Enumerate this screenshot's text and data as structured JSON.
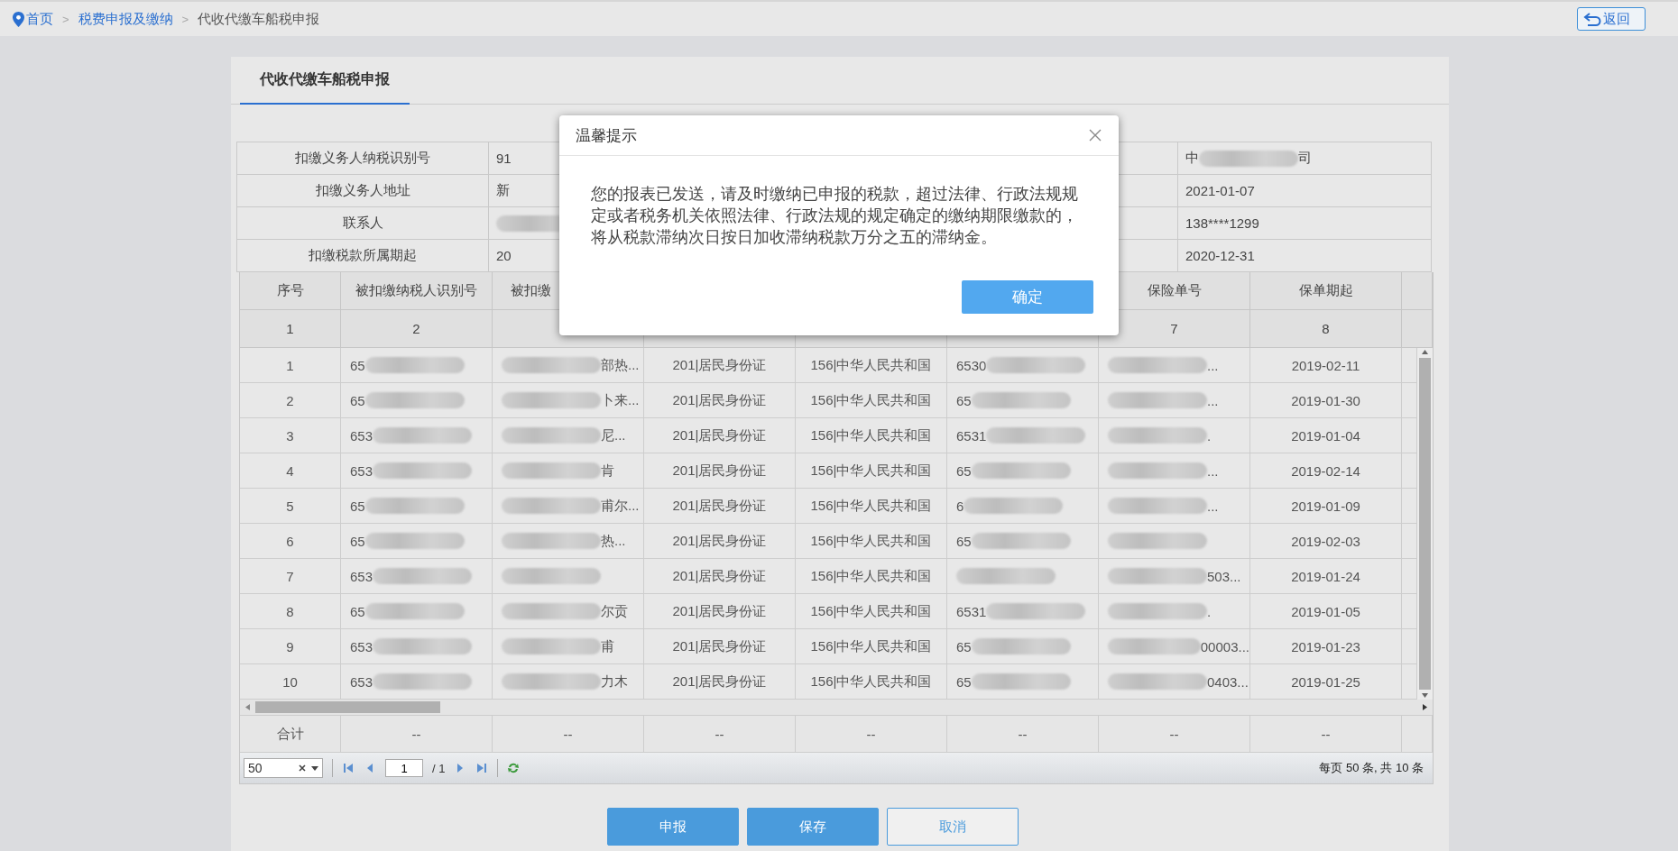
{
  "breadcrumb": [
    {
      "kind": "home",
      "label": "首页"
    },
    {
      "kind": "separator",
      "label": ">"
    },
    {
      "kind": "link",
      "label": "税费申报及缴纳"
    },
    {
      "kind": "separator",
      "label": ">"
    },
    {
      "kind": "current",
      "label": "代收代缴车船税申报"
    }
  ],
  "back_button": {
    "label": "返回"
  },
  "tabs": [
    {
      "label": "代收代缴车船税申报",
      "selected": true
    }
  ],
  "info_table": {
    "rows": [
      {
        "label": "扣缴义务人纳税识别号",
        "value": {
          "pre": "91"
        },
        "value_2": {
          "pre": "中",
          "post": "司",
          "redacted": true
        }
      },
      {
        "label": "扣缴义务人地址",
        "value": {
          "pre": "新"
        },
        "value_2": {
          "pre": "2021-01-07"
        }
      },
      {
        "label": "联系人",
        "value": {
          "redacted": true
        },
        "value_2": {
          "pre": "138****1299"
        }
      },
      {
        "label": "扣缴税款所属期起",
        "value": {
          "pre": "20"
        },
        "value_2": {
          "pre": "2020-12-31"
        }
      }
    ]
  },
  "grid": {
    "columns": [
      {
        "header": "序号",
        "index": "1"
      },
      {
        "header": "被扣缴纳税人识别号",
        "index": "2"
      },
      {
        "header": "被扣缴"
      },
      {},
      {},
      {},
      {
        "header": "保险单号",
        "index": "7"
      },
      {
        "header": "保单期起",
        "index": "8"
      }
    ],
    "rows": [
      {
        "cells": [
          {
            "pre": "1"
          },
          {
            "pre": "65",
            "redacted": true
          },
          {
            "post": "部热...",
            "redacted": true
          },
          {
            "pre": "201|居民身份证"
          },
          {
            "pre": "156|中华人民共和国"
          },
          {
            "pre": "6530",
            "redacted": true
          },
          {
            "post": "...",
            "redacted": true
          },
          {
            "pre": "2019-02-11"
          }
        ]
      },
      {
        "cells": [
          {
            "pre": "2"
          },
          {
            "pre": "65",
            "redacted": true
          },
          {
            "post": "卜来...",
            "redacted": true
          },
          {
            "pre": "201|居民身份证"
          },
          {
            "pre": "156|中华人民共和国"
          },
          {
            "pre": "65",
            "redacted": true
          },
          {
            "post": "...",
            "redacted": true
          },
          {
            "pre": "2019-01-30"
          }
        ]
      },
      {
        "cells": [
          {
            "pre": "3"
          },
          {
            "pre": "653",
            "redacted": true
          },
          {
            "post": "尼...",
            "redacted": true
          },
          {
            "pre": "201|居民身份证"
          },
          {
            "pre": "156|中华人民共和国"
          },
          {
            "pre": "6531",
            "redacted": true
          },
          {
            "post": ".",
            "redacted": true
          },
          {
            "pre": "2019-01-04"
          }
        ]
      },
      {
        "cells": [
          {
            "pre": "4"
          },
          {
            "pre": "653",
            "redacted": true
          },
          {
            "post": "肯",
            "redacted": true
          },
          {
            "pre": "201|居民身份证"
          },
          {
            "pre": "156|中华人民共和国"
          },
          {
            "pre": "65",
            "redacted": true
          },
          {
            "post": "...",
            "redacted": true
          },
          {
            "pre": "2019-02-14"
          }
        ]
      },
      {
        "cells": [
          {
            "pre": "5"
          },
          {
            "pre": "65",
            "redacted": true
          },
          {
            "post": "甫尔...",
            "redacted": true
          },
          {
            "pre": "201|居民身份证"
          },
          {
            "pre": "156|中华人民共和国"
          },
          {
            "pre": "6",
            "redacted": true
          },
          {
            "post": "...",
            "redacted": true
          },
          {
            "pre": "2019-01-09"
          }
        ]
      },
      {
        "cells": [
          {
            "pre": "6"
          },
          {
            "pre": "65",
            "redacted": true
          },
          {
            "post": "热...",
            "redacted": true
          },
          {
            "pre": "201|居民身份证"
          },
          {
            "pre": "156|中华人民共和国"
          },
          {
            "pre": "65",
            "redacted": true
          },
          {
            "redacted": true
          },
          {
            "pre": "2019-02-03"
          }
        ]
      },
      {
        "cells": [
          {
            "pre": "7"
          },
          {
            "pre": "653",
            "redacted": true
          },
          {
            "redacted": true
          },
          {
            "pre": "201|居民身份证"
          },
          {
            "pre": "156|中华人民共和国"
          },
          {
            "redacted": true
          },
          {
            "post": "503...",
            "redacted": true
          },
          {
            "pre": "2019-01-24"
          }
        ]
      },
      {
        "cells": [
          {
            "pre": "8"
          },
          {
            "pre": "65",
            "redacted": true
          },
          {
            "post": "尔贡",
            "redacted": true
          },
          {
            "pre": "201|居民身份证"
          },
          {
            "pre": "156|中华人民共和国"
          },
          {
            "pre": "6531",
            "redacted": true
          },
          {
            "post": ".",
            "redacted": true
          },
          {
            "pre": "2019-01-05"
          }
        ]
      },
      {
        "cells": [
          {
            "pre": "9"
          },
          {
            "pre": "653",
            "redacted": true
          },
          {
            "post": "甫",
            "redacted": true
          },
          {
            "pre": "201|居民身份证"
          },
          {
            "pre": "156|中华人民共和国"
          },
          {
            "pre": "65",
            "redacted": true
          },
          {
            "post": "00003...",
            "redacted": true
          },
          {
            "pre": "2019-01-23"
          }
        ]
      },
      {
        "cells": [
          {
            "pre": "10"
          },
          {
            "pre": "653",
            "redacted": true
          },
          {
            "post": "力木",
            "redacted": true
          },
          {
            "pre": "201|居民身份证"
          },
          {
            "pre": "156|中华人民共和国"
          },
          {
            "pre": "65",
            "redacted": true
          },
          {
            "post": "0403...",
            "redacted": true
          },
          {
            "pre": "2019-01-25"
          }
        ]
      }
    ],
    "totals": {
      "label": "合计",
      "values": [
        "--",
        "--",
        "--",
        "--",
        "--",
        "--",
        "--"
      ]
    }
  },
  "pager": {
    "page_size": "50",
    "page": "1",
    "pages": "/ 1",
    "summary": "每页 50 条, 共 10 条"
  },
  "buttons": [
    {
      "label": "申报",
      "kind": "primary"
    },
    {
      "label": "保存",
      "kind": "primary"
    },
    {
      "label": "取消",
      "kind": "secondary"
    }
  ],
  "dialog": {
    "title": "温馨提示",
    "message": "您的报表已发送，请及时缴纳已申报的税款，超过法律、行政法规规定或者税务机关依照法律、行政法规的规定确定的缴纳期限缴款的，将从税款滞纳次日按日加收滞纳税款万分之五的滞纳金。",
    "confirm": "确定"
  }
}
